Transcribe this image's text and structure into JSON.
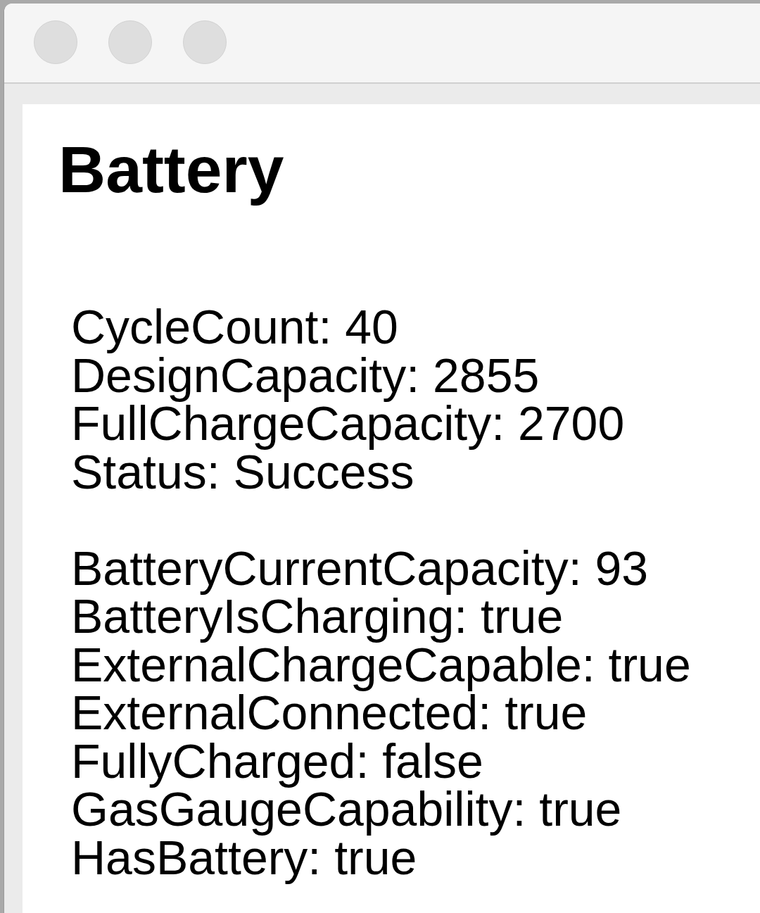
{
  "window": {
    "focused": false
  },
  "content": {
    "heading": "Battery",
    "groups": [
      {
        "lines": [
          "CycleCount: 40",
          "DesignCapacity: 2855",
          "FullChargeCapacity: 2700",
          "Status: Success"
        ]
      },
      {
        "lines": [
          "BatteryCurrentCapacity: 93",
          "BatteryIsCharging: true",
          "ExternalChargeCapable: true",
          "ExternalConnected: true",
          "FullyCharged: false",
          "GasGaugeCapability: true",
          "HasBattery: true"
        ]
      }
    ]
  }
}
